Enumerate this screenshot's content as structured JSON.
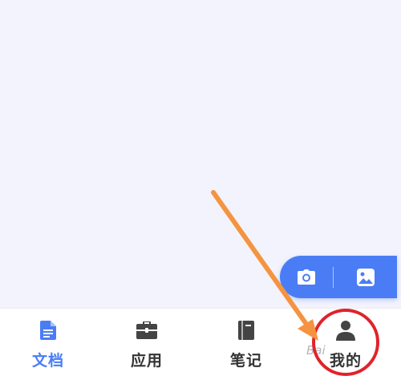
{
  "colors": {
    "accent": "#4a7df5",
    "background": "#f2f3fc",
    "tab_text": "#333333",
    "annotation_red": "#e0232b",
    "annotation_orange": "#f59440"
  },
  "fab": {
    "camera_icon": "camera-icon",
    "gallery_icon": "image-icon"
  },
  "tabs": [
    {
      "id": "docs",
      "label": "文档",
      "icon": "document-icon",
      "active": true
    },
    {
      "id": "apps",
      "label": "应用",
      "icon": "briefcase-icon",
      "active": false
    },
    {
      "id": "notes",
      "label": "笔记",
      "icon": "notebook-icon",
      "active": false
    },
    {
      "id": "mine",
      "label": "我的",
      "icon": "person-icon",
      "active": false
    }
  ],
  "watermark": "Bai"
}
